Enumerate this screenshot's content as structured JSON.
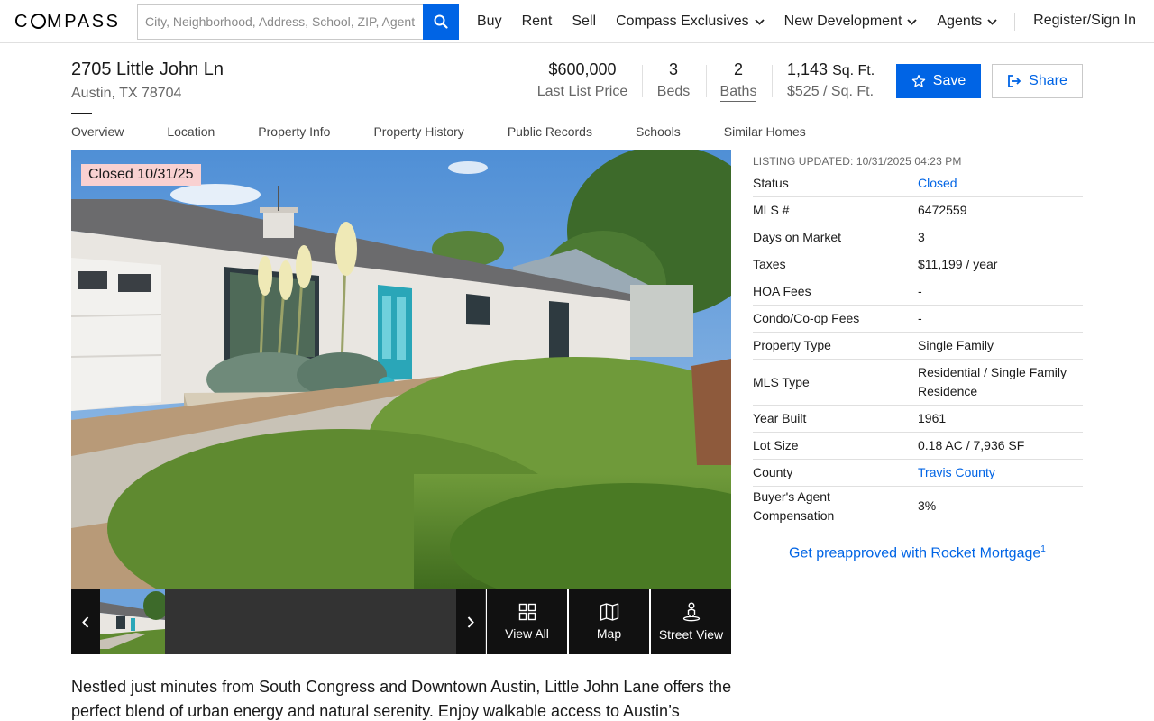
{
  "nav": {
    "logo": "COMPASS",
    "search_placeholder": "City, Neighborhood, Address, School, ZIP, Agent",
    "links": [
      "Buy",
      "Rent",
      "Sell",
      "Compass Exclusives",
      "New Development",
      "Agents"
    ],
    "signin": "Register/Sign In"
  },
  "listing": {
    "street": "2705 Little John Ln",
    "city": "Austin, TX 78704",
    "price": "$600,000",
    "price_label": "Last List Price",
    "beds": "3",
    "beds_label": "Beds",
    "baths": "2",
    "baths_label": "Baths",
    "sqft": "1,143",
    "sqft_unit": "Sq. Ft.",
    "price_per_sqft": "$525 / Sq. Ft.",
    "save_label": "Save",
    "share_label": "Share"
  },
  "tabs": [
    "Overview",
    "Location",
    "Property Info",
    "Property History",
    "Public Records",
    "Schools",
    "Similar Homes"
  ],
  "photo": {
    "badge": "Closed 10/31/25",
    "buttons": {
      "view_all": "View All",
      "map": "Map",
      "street_view": "Street View"
    }
  },
  "facts": {
    "updated": "LISTING UPDATED: 10/31/2025 04:23 PM",
    "rows": [
      {
        "k": "Status",
        "v": "Closed"
      },
      {
        "k": "MLS #",
        "v": "6472559"
      },
      {
        "k": "Days on Market",
        "v": "3"
      },
      {
        "k": "Taxes",
        "v": "$11,199 / year"
      },
      {
        "k": "HOA Fees",
        "v": "-"
      },
      {
        "k": "Condo/Co-op Fees",
        "v": "-"
      },
      {
        "k": "Property Type",
        "v": "Single Family"
      },
      {
        "k": "MLS Type",
        "v": "Residential / Single Family Residence"
      },
      {
        "k": "Year Built",
        "v": "1961"
      },
      {
        "k": "Lot Size",
        "v": "0.18 AC / 7,936 SF"
      },
      {
        "k": "County",
        "v": "Travis County"
      },
      {
        "k": "Buyer's Agent Compensation",
        "v": "3%"
      }
    ],
    "rocket": "Get preapproved with Rocket Mortgage",
    "rocket_sup": "1"
  },
  "description": "Nestled just minutes from South Congress and Downtown Austin, Little John Lane offers the perfect blend of urban energy and natural serenity. Enjoy walkable access to Austin’s",
  "colors": {
    "accent": "#0064e5",
    "badge_bg": "#f9d1d1",
    "dark_strip": "#111111"
  }
}
